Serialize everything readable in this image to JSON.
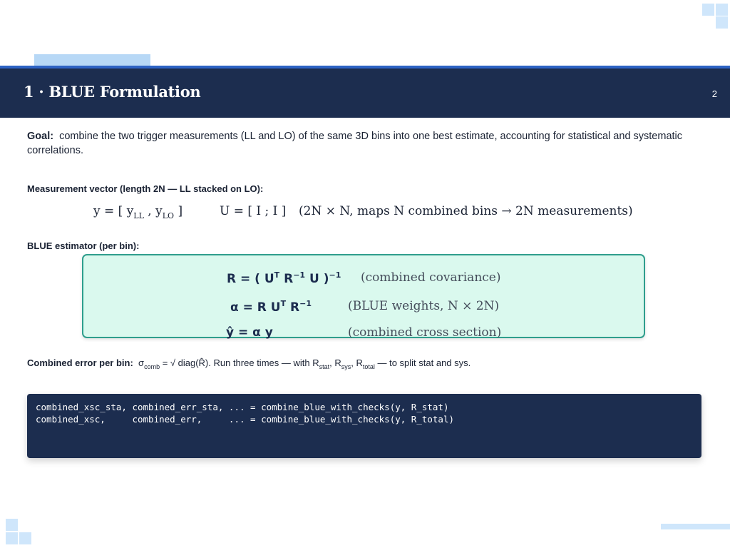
{
  "header": {
    "title": "1 · BLUE Formulation",
    "page_number": "2"
  },
  "goal": {
    "label": "Goal:",
    "text": "combine the two trigger measurements (LL and LO) of the same 3D bins into one best estimate, accounting for statistical and systematic correlations."
  },
  "measurement": {
    "heading": "Measurement vector (length 2N — LL stacked on LO):",
    "y_prefix": "y = [ y",
    "y_sub_ll": "LL",
    "y_mid": " , y",
    "y_sub_lo": "LO",
    "y_suffix": " ]",
    "u_eq": "U = [ I ; I ]",
    "u_note": "(2N × N, maps N combined bins → 2N measurements)"
  },
  "estimator": {
    "heading": "BLUE estimator (per bin):",
    "f1_a": "R = ( U",
    "f1_sup1": "T",
    "f1_b": " R",
    "f1_sup2": "−1",
    "f1_c": " U )",
    "f1_sup3": "−1",
    "f1_note": "(combined covariance)",
    "f2_a": "α = R U",
    "f2_sup1": "T",
    "f2_b": " R",
    "f2_sup2": "−1",
    "f2_note": "(BLUE weights, N × 2N)",
    "f3": "ŷ = α y",
    "f3_note": "(combined cross section)"
  },
  "combined_error": {
    "label": "Combined error per bin:",
    "sigma": "σ",
    "sigma_sub": "comb",
    "eq": " = √ diag(R̂).   Run three times — with R",
    "sub_stat": "stat",
    "sep1": ", R",
    "sub_sys": "sys",
    "sep2": ", R",
    "sub_total": "total",
    "tail": " — to split stat and sys."
  },
  "code": {
    "line1": "combined_xsc_sta, combined_err_sta, ... = combine_blue_with_checks(y, R_stat)",
    "line2": "combined_xsc,     combined_err,     ... = combine_blue_with_checks(y, R_total)"
  },
  "colors": {
    "header_bg": "#1c2d4f",
    "accent_blue": "#2d63c4",
    "box_fill": "#daf9ee",
    "box_border": "#2f9e8d",
    "decor_light_blue": "#cfe6fb"
  }
}
